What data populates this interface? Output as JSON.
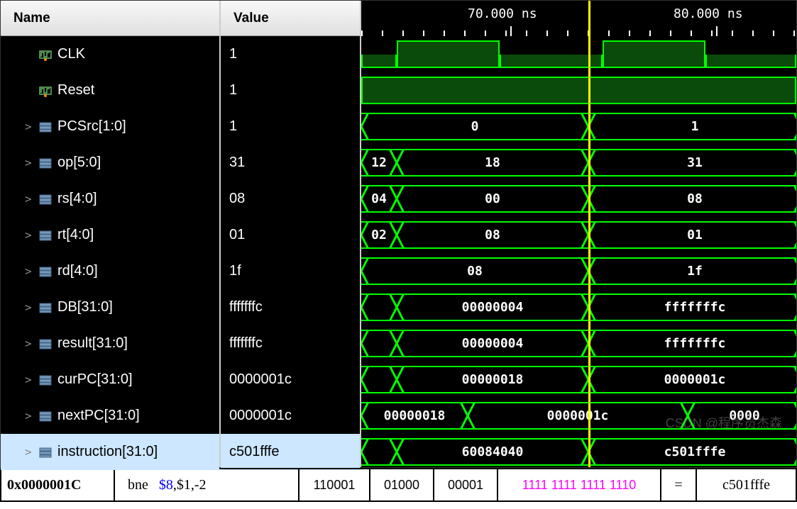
{
  "headers": {
    "name": "Name",
    "value": "Value"
  },
  "timescale": {
    "t1": "70.000 ns",
    "t2": "80.000 ns"
  },
  "signals": [
    {
      "name": "CLK",
      "value": "1",
      "type": "clock",
      "icon": "clock"
    },
    {
      "name": "Reset",
      "value": "1",
      "type": "high",
      "icon": "clock"
    },
    {
      "name": "PCSrc[1:0]",
      "value": "1",
      "type": "bus",
      "icon": "bus",
      "segs": [
        {
          "v": "0",
          "l": 0,
          "r": 320
        },
        {
          "v": "1",
          "l": 320,
          "r": 620
        }
      ]
    },
    {
      "name": "op[5:0]",
      "value": "31",
      "type": "bus",
      "icon": "bus",
      "segs": [
        {
          "v": "12",
          "l": 0,
          "r": 50
        },
        {
          "v": "18",
          "l": 50,
          "r": 320
        },
        {
          "v": "31",
          "l": 320,
          "r": 620
        }
      ]
    },
    {
      "name": "rs[4:0]",
      "value": "08",
      "type": "bus",
      "icon": "bus",
      "segs": [
        {
          "v": "04",
          "l": 0,
          "r": 50
        },
        {
          "v": "00",
          "l": 50,
          "r": 320
        },
        {
          "v": "08",
          "l": 320,
          "r": 620
        }
      ]
    },
    {
      "name": "rt[4:0]",
      "value": "01",
      "type": "bus",
      "icon": "bus",
      "segs": [
        {
          "v": "02",
          "l": 0,
          "r": 50
        },
        {
          "v": "08",
          "l": 50,
          "r": 320
        },
        {
          "v": "01",
          "l": 320,
          "r": 620
        }
      ]
    },
    {
      "name": "rd[4:0]",
      "value": "1f",
      "type": "bus",
      "icon": "bus",
      "segs": [
        {
          "v": "08",
          "l": 0,
          "r": 320
        },
        {
          "v": "1f",
          "l": 320,
          "r": 620
        }
      ]
    },
    {
      "name": "DB[31:0]",
      "value": "fffffffc",
      "type": "bus",
      "icon": "bus",
      "segs": [
        {
          "v": "",
          "l": 0,
          "r": 50
        },
        {
          "v": "00000004",
          "l": 50,
          "r": 320
        },
        {
          "v": "fffffffc",
          "l": 320,
          "r": 620
        }
      ]
    },
    {
      "name": "result[31:0]",
      "value": "fffffffc",
      "type": "bus",
      "icon": "bus",
      "segs": [
        {
          "v": "",
          "l": 0,
          "r": 50
        },
        {
          "v": "00000004",
          "l": 50,
          "r": 320
        },
        {
          "v": "fffffffc",
          "l": 320,
          "r": 620
        }
      ]
    },
    {
      "name": "curPC[31:0]",
      "value": "0000001c",
      "type": "bus",
      "icon": "bus",
      "segs": [
        {
          "v": "",
          "l": 0,
          "r": 50
        },
        {
          "v": "00000018",
          "l": 50,
          "r": 320
        },
        {
          "v": "0000001c",
          "l": 320,
          "r": 620
        }
      ]
    },
    {
      "name": "nextPC[31:0]",
      "value": "0000001c",
      "type": "bus",
      "icon": "bus",
      "segs": [
        {
          "v": "00000018",
          "l": 0,
          "r": 150
        },
        {
          "v": "0000001c",
          "l": 150,
          "r": 460
        },
        {
          "v": "0000",
          "l": 460,
          "r": 620
        }
      ]
    },
    {
      "name": "instruction[31:0]",
      "value": "c501fffe",
      "type": "bus",
      "icon": "bus",
      "highlighted": true,
      "segs": [
        {
          "v": "",
          "l": 0,
          "r": 50
        },
        {
          "v": "60084040",
          "l": 50,
          "r": 320
        },
        {
          "v": "c501fffe",
          "l": 320,
          "r": 620
        }
      ]
    }
  ],
  "bottom": {
    "addr": "0x0000001C",
    "instr_mnemonic": "bne",
    "instr_reg": "$8",
    "instr_rest": ",$1,-2",
    "f_op": "110001",
    "f_rs": "01000",
    "f_rt": "00001",
    "f_imm": "1111 1111 1111 1110",
    "eq": "=",
    "hex": "c501fffe"
  },
  "watermark": "CSDN @程序员杰森"
}
